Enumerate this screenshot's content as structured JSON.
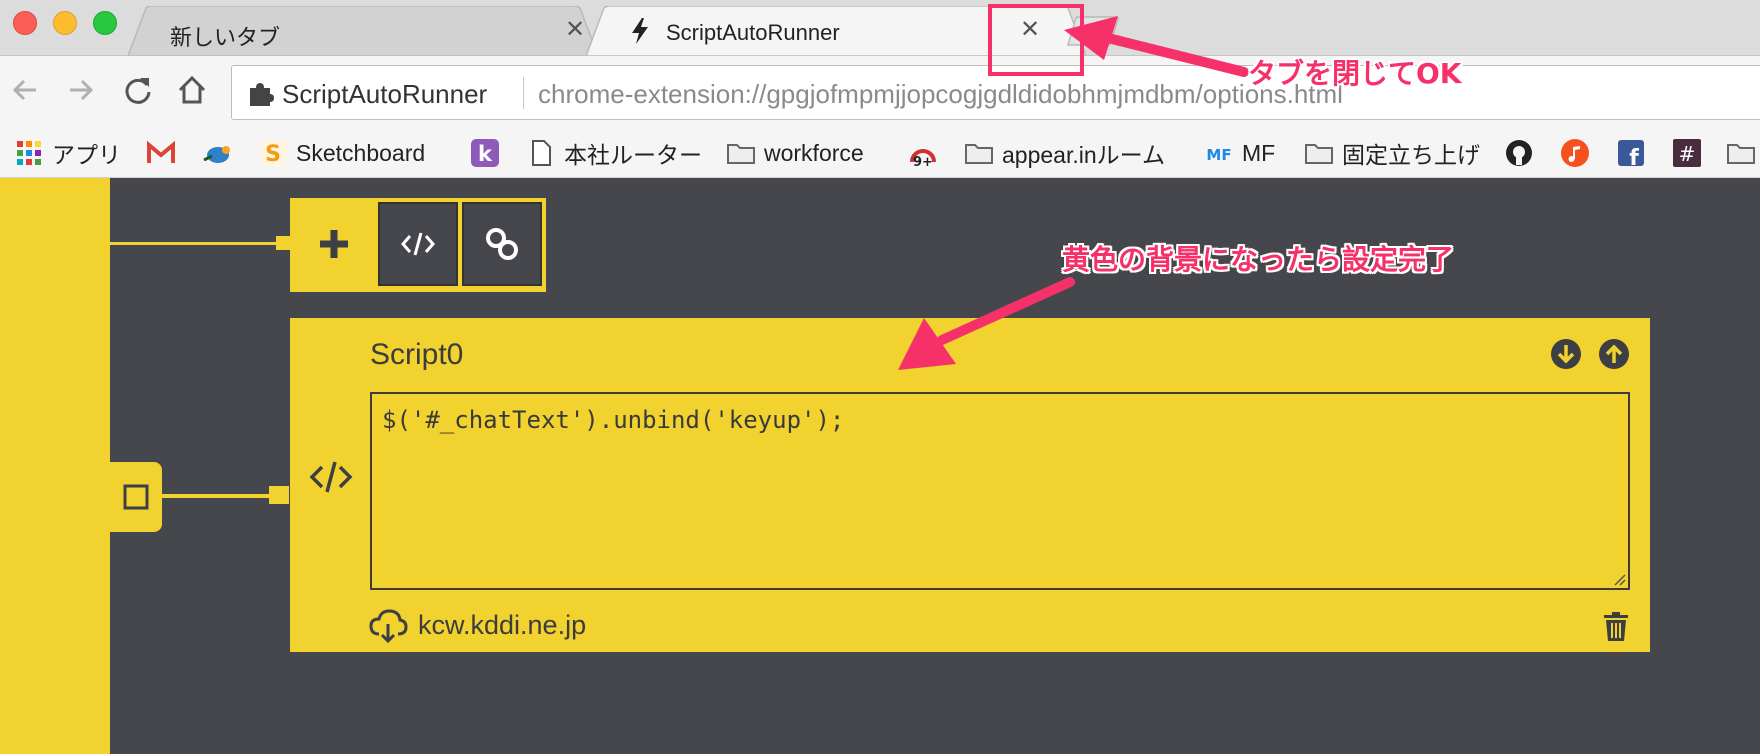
{
  "tabs": [
    {
      "title": "新しいタブ",
      "close_glyph": "✕",
      "active": false
    },
    {
      "title": "ScriptAutoRunner",
      "close_glyph": "✕",
      "active": true,
      "icon": "bolt-icon"
    }
  ],
  "toolbar": {
    "back_icon": "back-arrow-icon",
    "forward_icon": "forward-arrow-icon",
    "reload_icon": "reload-icon",
    "home_icon": "home-icon",
    "extension_name": "ScriptAutoRunner",
    "url": "chrome-extension://gpgjofmpmjjopcogjgdldidobhmjmdbm/options.html"
  },
  "bookmarks": [
    {
      "label": "アプリ",
      "icon": "apps-grid-icon"
    },
    {
      "label": "",
      "icon": "gmail-icon"
    },
    {
      "label": "",
      "icon": "bird-icon"
    },
    {
      "label": "Sketchboard",
      "icon": "sketchboard-icon"
    },
    {
      "label": "",
      "icon": "k-icon"
    },
    {
      "label": "本社ルーター",
      "icon": "page-icon"
    },
    {
      "label": "workforce",
      "icon": "folder-icon"
    },
    {
      "label": "",
      "icon": "nine-plus-icon"
    },
    {
      "label": "appear.inルーム",
      "icon": "folder-icon"
    },
    {
      "label": "MF",
      "icon": "mf-icon"
    },
    {
      "label": "固定立ち上げ",
      "icon": "folder-icon"
    },
    {
      "label": "",
      "icon": "github-icon"
    },
    {
      "label": "",
      "icon": "music-icon"
    },
    {
      "label": "",
      "icon": "facebook-icon"
    },
    {
      "label": "",
      "icon": "hash-icon"
    },
    {
      "label": "",
      "icon": "folder-icon"
    }
  ],
  "app": {
    "add_icon": "plus-icon",
    "code_icon": "code-icon",
    "link_icon": "link-icon",
    "node_icon": "square-icon",
    "script": {
      "name": "Script0",
      "code": "$('#_chatText').unbind('keyup');",
      "host": "kcw.kddi.ne.jp",
      "host_icon": "cloud-download-icon",
      "move_down_icon": "arrow-down-circle-icon",
      "move_up_icon": "arrow-up-circle-icon",
      "delete_icon": "trash-icon"
    }
  },
  "annotations": {
    "close_tab": "タブを閉じてOK",
    "yellow_done": "黄色の背景になったら設定完了"
  },
  "colors": {
    "accent_yellow": "#f2d22e",
    "page_dark": "#45474d",
    "annotation_pink": "#f6316a"
  }
}
